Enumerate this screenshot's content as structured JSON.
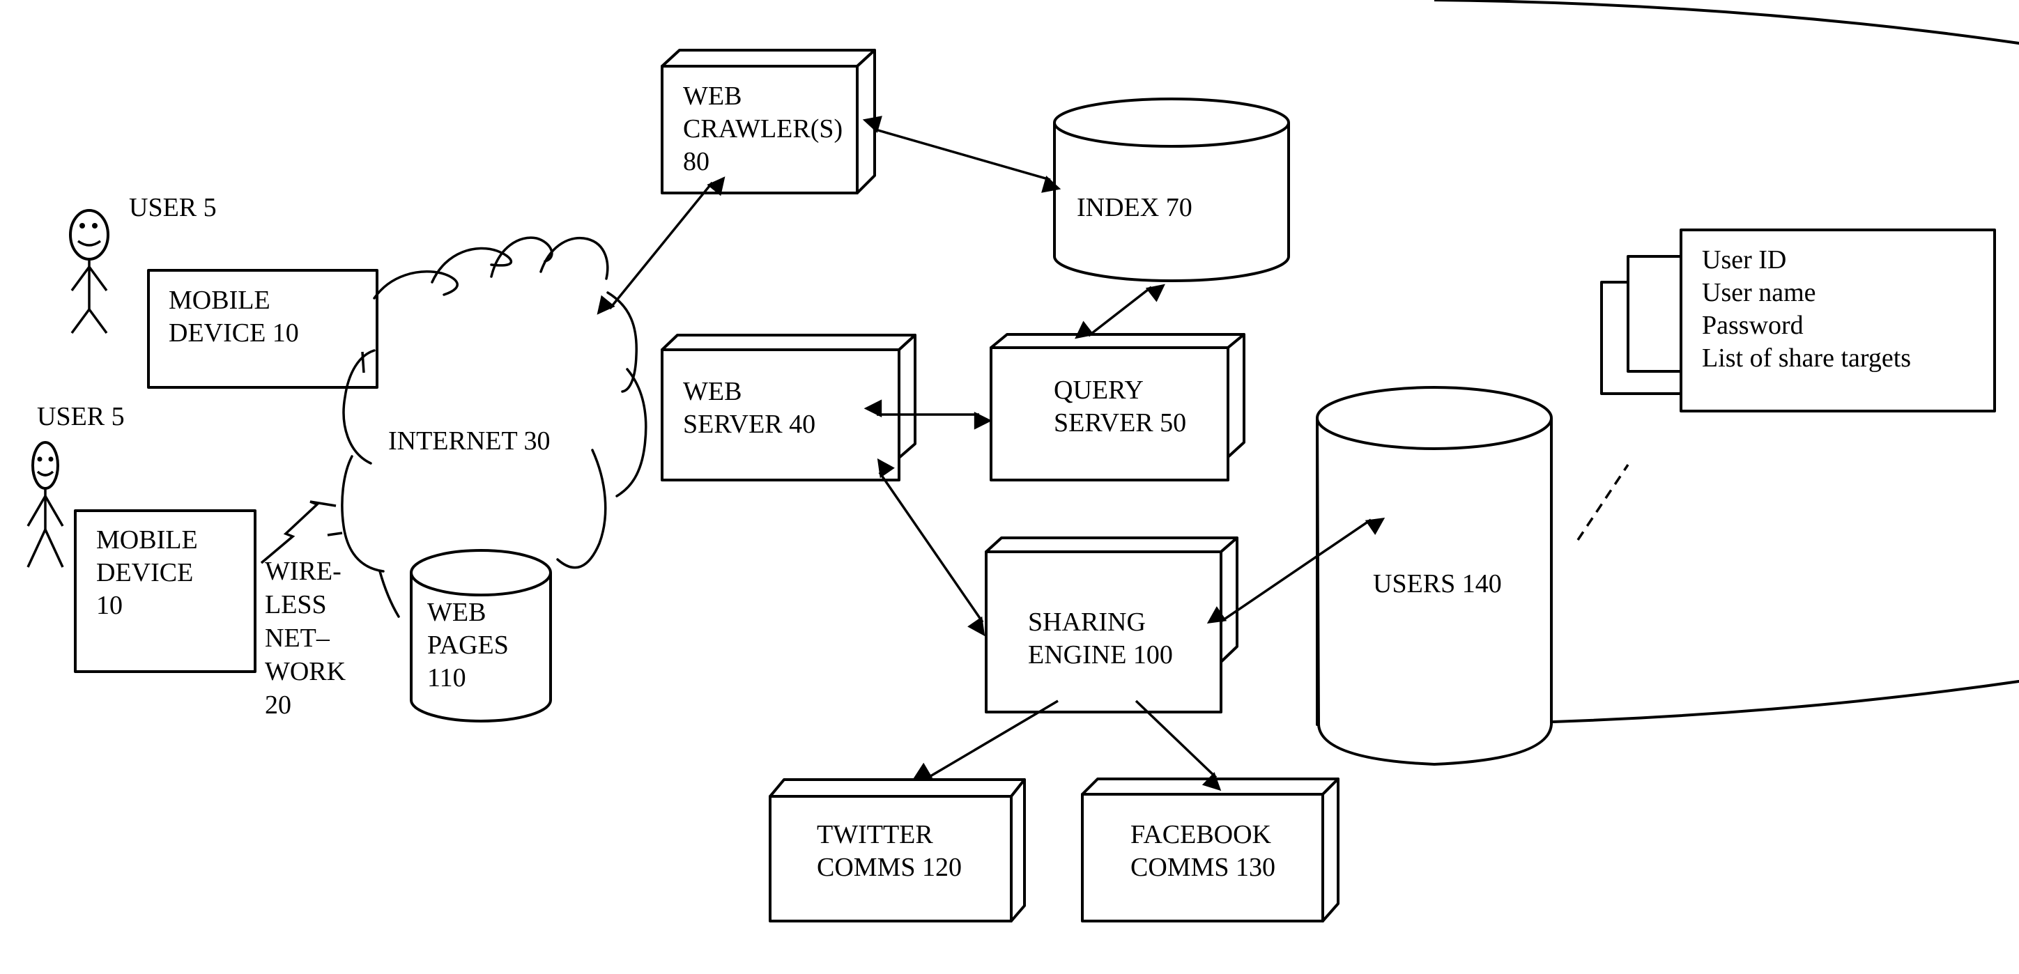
{
  "diagram": {
    "users": [
      {
        "label": "USER 5"
      },
      {
        "label": "USER 5"
      }
    ],
    "mobile_device_top": {
      "lines": [
        "MOBILE",
        "DEVICE 10"
      ]
    },
    "mobile_device_bottom": {
      "lines": [
        "MOBILE",
        "DEVICE",
        "10"
      ]
    },
    "wireless_network": {
      "lines": [
        "WIRE-",
        "LESS",
        "NET–",
        "WORK",
        "20"
      ]
    },
    "internet": {
      "label": "INTERNET 30"
    },
    "web_pages": {
      "lines": [
        "WEB",
        "PAGES",
        "110"
      ]
    },
    "web_crawlers": {
      "lines": [
        "WEB",
        "CRAWLER(S)",
        "80"
      ]
    },
    "index": {
      "label": "INDEX 70"
    },
    "web_server": {
      "lines": [
        "WEB",
        "SERVER 40"
      ]
    },
    "query_server": {
      "lines": [
        "QUERY",
        "SERVER 50"
      ]
    },
    "sharing_engine": {
      "lines": [
        "SHARING",
        "ENGINE 100"
      ]
    },
    "twitter_comms": {
      "lines": [
        "TWITTER",
        "COMMS 120"
      ]
    },
    "facebook_comms": {
      "lines": [
        "FACEBOOK",
        "COMMS 130"
      ]
    },
    "users_db": {
      "label": "USERS 140"
    },
    "user_record": {
      "fields": [
        "User ID",
        "User name",
        "Password",
        "List of share targets"
      ]
    },
    "connections": [
      {
        "from": "internet",
        "to": "web_crawlers",
        "type": "bidirectional"
      },
      {
        "from": "web_crawlers",
        "to": "index",
        "type": "bidirectional"
      },
      {
        "from": "index",
        "to": "query_server",
        "type": "bidirectional"
      },
      {
        "from": "web_server",
        "to": "query_server",
        "type": "bidirectional"
      },
      {
        "from": "web_server",
        "to": "sharing_engine",
        "type": "bidirectional"
      },
      {
        "from": "sharing_engine",
        "to": "users_db",
        "type": "bidirectional"
      },
      {
        "from": "sharing_engine",
        "to": "twitter_comms",
        "type": "directed"
      },
      {
        "from": "sharing_engine",
        "to": "facebook_comms",
        "type": "directed"
      },
      {
        "from": "users_db",
        "to": "user_record",
        "type": "dashed"
      },
      {
        "from": "mobile_device_bottom",
        "to": "internet",
        "type": "wireless"
      }
    ]
  }
}
